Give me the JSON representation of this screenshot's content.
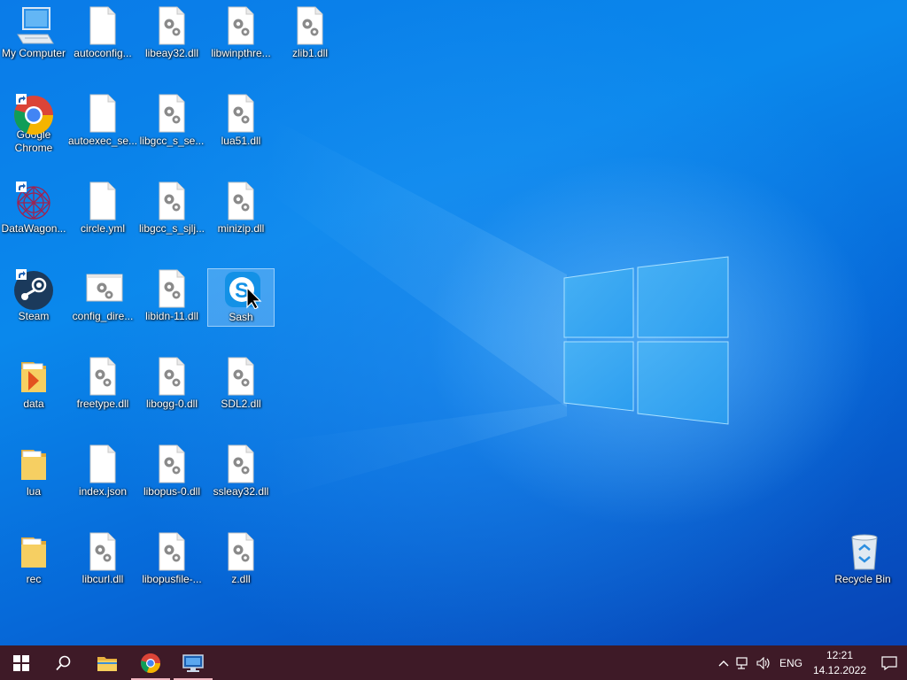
{
  "desktop": {
    "icons": [
      {
        "label": "My Computer",
        "type": "computer"
      },
      {
        "label": "Google Chrome",
        "type": "chrome"
      },
      {
        "label": "DataWagon...",
        "type": "datawagon"
      },
      {
        "label": "Steam",
        "type": "steam"
      },
      {
        "label": "data",
        "type": "folder-arrow"
      },
      {
        "label": "lua",
        "type": "folder"
      },
      {
        "label": "rec",
        "type": "folder"
      },
      {
        "label": "autoconfig...",
        "type": "blank-file"
      },
      {
        "label": "autoexec_se...",
        "type": "blank-file"
      },
      {
        "label": "circle.yml",
        "type": "blank-file"
      },
      {
        "label": "config_dire...",
        "type": "config-file"
      },
      {
        "label": "freetype.dll",
        "type": "dll"
      },
      {
        "label": "index.json",
        "type": "blank-file"
      },
      {
        "label": "libcurl.dll",
        "type": "dll"
      },
      {
        "label": "libeay32.dll",
        "type": "dll"
      },
      {
        "label": "libgcc_s_se...",
        "type": "dll"
      },
      {
        "label": "libgcc_s_sjlj...",
        "type": "dll"
      },
      {
        "label": "libidn-11.dll",
        "type": "dll"
      },
      {
        "label": "libogg-0.dll",
        "type": "dll"
      },
      {
        "label": "libopus-0.dll",
        "type": "dll"
      },
      {
        "label": "libopusfile-...",
        "type": "dll"
      },
      {
        "label": "libwinpthre...",
        "type": "dll"
      },
      {
        "label": "lua51.dll",
        "type": "dll"
      },
      {
        "label": "minizip.dll",
        "type": "dll"
      },
      {
        "label": "Sash",
        "type": "skype",
        "selected": true
      },
      {
        "label": "SDL2.dll",
        "type": "dll"
      },
      {
        "label": "ssleay32.dll",
        "type": "dll"
      },
      {
        "label": "z.dll",
        "type": "dll"
      },
      {
        "label": "zlib1.dll",
        "type": "dll"
      },
      {
        "label": "Recycle Bin",
        "type": "recycle-bin"
      }
    ]
  },
  "taskbar": {
    "start": {
      "icon": "windows-logo-icon"
    },
    "search": {
      "icon": "search-icon"
    },
    "pinned": [
      {
        "name": "file-explorer",
        "icon": "folder-icon",
        "running": false
      },
      {
        "name": "google-chrome",
        "icon": "chrome-icon",
        "running": true
      },
      {
        "name": "remote-desktop",
        "icon": "monitor-icon",
        "running": true
      }
    ],
    "tray": {
      "language": "ENG",
      "time": "12:21",
      "date": "14.12.2022"
    }
  },
  "colors": {
    "taskbar": "#3e1a27",
    "selection": "#bee1ff"
  }
}
